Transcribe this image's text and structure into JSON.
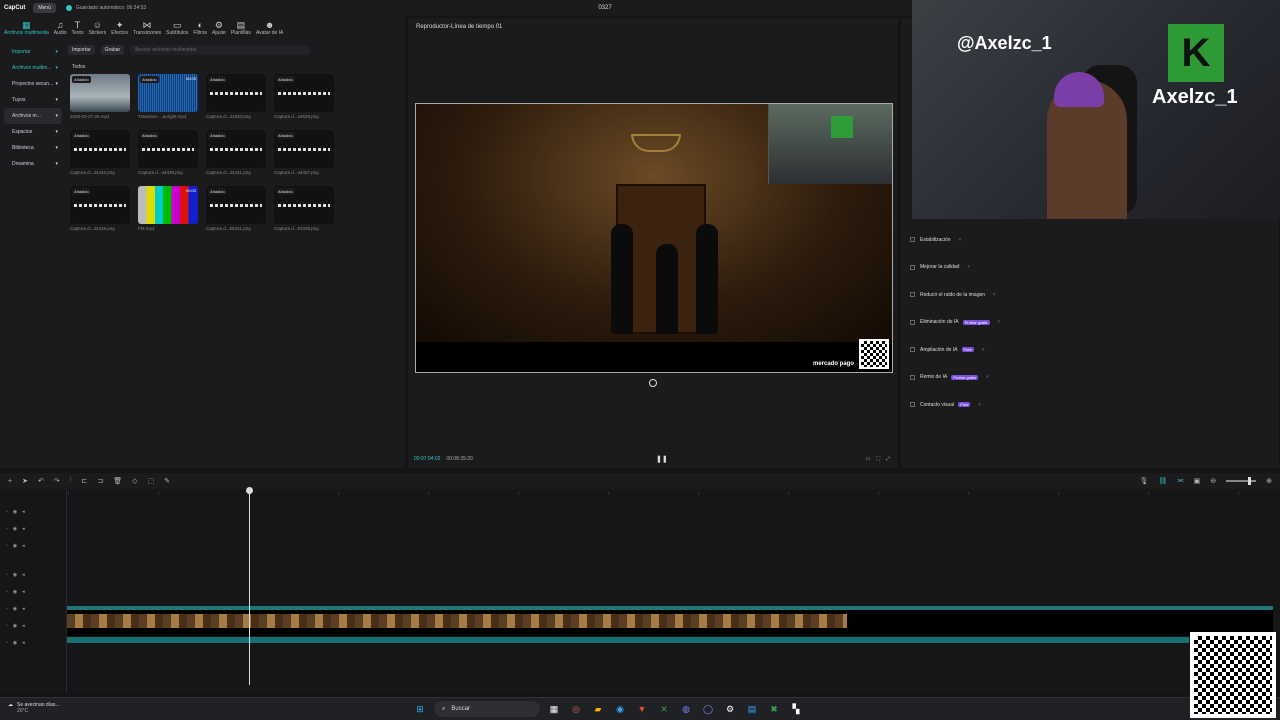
{
  "titlebar": {
    "app": "CapCut",
    "menu": "Menú",
    "autosave": "Guardado automático: 06:34:53",
    "project": "0327"
  },
  "toolbar": [
    {
      "icon": "media-icon",
      "label": "Archivos multimedia",
      "active": true
    },
    {
      "icon": "audio-icon",
      "label": "Audio"
    },
    {
      "icon": "text-icon",
      "label": "Texto"
    },
    {
      "icon": "sticker-icon",
      "label": "Stickers"
    },
    {
      "icon": "effects-icon",
      "label": "Efectos"
    },
    {
      "icon": "transitions-icon",
      "label": "Transiciones"
    },
    {
      "icon": "subtitles-icon",
      "label": "Subtítulos"
    },
    {
      "icon": "filters-icon",
      "label": "Filtros"
    },
    {
      "icon": "adjust-icon",
      "label": "Ajuste"
    },
    {
      "icon": "templates-icon",
      "label": "Plantillas"
    },
    {
      "icon": "avatar-icon",
      "label": "Avatar de IA"
    }
  ],
  "leftnav": [
    {
      "label": "Importar",
      "hl": true
    },
    {
      "label": "Archivos multim...",
      "hl": true
    },
    {
      "label": "Proyectos secun..."
    },
    {
      "label": "Tuyos"
    },
    {
      "label": "Archivos m...",
      "sel": true
    },
    {
      "label": "Espacios"
    },
    {
      "label": "Biblioteca"
    },
    {
      "label": "Dreamina"
    }
  ],
  "mediabar": {
    "import": "Importar",
    "record": "Grabar",
    "search_placeholder": "Buscar archivos multimedia"
  },
  "media_heading": "Todos",
  "media": [
    {
      "badge": "Añadido",
      "dur": "",
      "cap": "2026-03-27-26.mp4",
      "style": "t-scene"
    },
    {
      "badge": "Añadido",
      "dur": "00:05",
      "cap": "Transition ...puright.mp4",
      "style": "t-wave"
    },
    {
      "badge": "Añadido",
      "dur": "",
      "cap": "Captura d...41920.png",
      "style": "t-dark"
    },
    {
      "badge": "Añadido",
      "dur": "",
      "cap": "Captura d...44628.png",
      "style": "t-dark"
    },
    {
      "badge": "Añadido",
      "dur": "",
      "cap": "Captura d...44442.png",
      "style": "t-dark"
    },
    {
      "badge": "Añadido",
      "dur": "",
      "cap": "Captura d...44438.png",
      "style": "t-dark"
    },
    {
      "badge": "Añadido",
      "dur": "",
      "cap": "Captura d...44431.png",
      "style": "t-dark"
    },
    {
      "badge": "Añadido",
      "dur": "",
      "cap": "Captura d...44427.png",
      "style": "t-dark"
    },
    {
      "badge": "Añadido",
      "dur": "",
      "cap": "Captura d...44418.png",
      "style": "t-dark"
    },
    {
      "badge": "",
      "dur": "00:03",
      "cap": "FM.mp4",
      "style": "t-bars"
    },
    {
      "badge": "Añadido",
      "dur": "",
      "cap": "Captura d...50441.png",
      "style": "t-dark"
    },
    {
      "badge": "Añadido",
      "dur": "",
      "cap": "Captura d...81028.png",
      "style": "t-dark"
    }
  ],
  "player": {
    "title": "Reproductor-Línea de tiempo 01",
    "current": "00:07:04:02",
    "total": "00:08:35:20",
    "brand": "mercado pago"
  },
  "webcam": {
    "handle": "@Axelzc_1",
    "name": "Axelzc_1",
    "letter": "K"
  },
  "properties": [
    {
      "label": "Estabilización",
      "tag": ""
    },
    {
      "label": "Mejorar la calidad",
      "tag": ""
    },
    {
      "label": "Reducir el ruido de la imagen",
      "tag": ""
    },
    {
      "label": "Eliminación de IA",
      "tag": "Probar gratis"
    },
    {
      "label": "Ampliación de IA",
      "tag": "Free"
    },
    {
      "label": "Remix de IA",
      "tag": "Probar gratis"
    },
    {
      "label": "Contacto visual",
      "tag": "Free"
    }
  ],
  "taskbar": {
    "weather_line1": "Se avecinan días...",
    "weather_line2": "20°C",
    "search": "Buscar"
  }
}
